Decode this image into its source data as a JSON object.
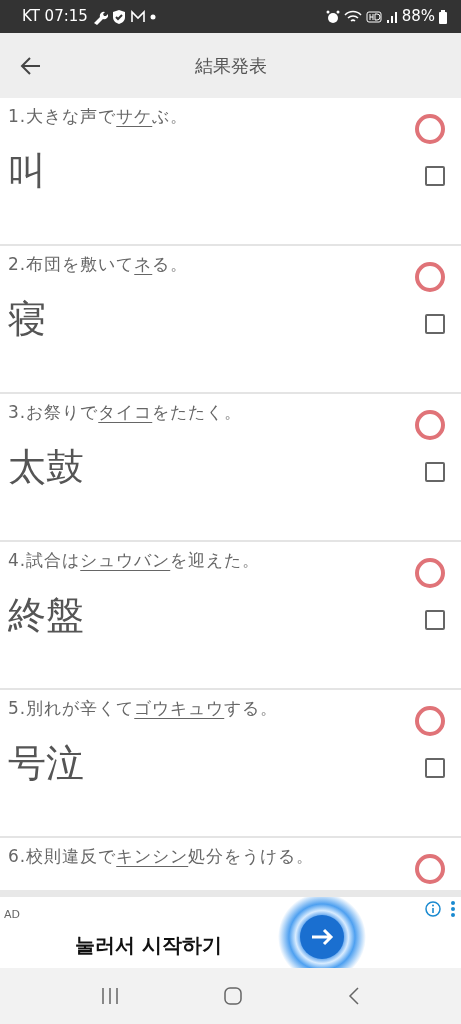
{
  "status_bar": {
    "carrier_time": "KT 07:15",
    "battery": "88%"
  },
  "app_bar": {
    "title": "結果発表"
  },
  "questions": [
    {
      "number": "1.",
      "before": "大きな声で",
      "underlined": "サケ",
      "after": "ぶ。",
      "answer": "叫",
      "correct": true,
      "checked": false
    },
    {
      "number": "2.",
      "before": "布団を敷いて",
      "underlined": "ネ",
      "after": "る。",
      "answer": "寝",
      "correct": true,
      "checked": false
    },
    {
      "number": "3.",
      "before": "お祭りで",
      "underlined": "タイコ",
      "after": "をたたく。",
      "answer": "太鼓",
      "correct": true,
      "checked": false
    },
    {
      "number": "4.",
      "before": "試合は",
      "underlined": "シュウバン",
      "after": "を迎えた。",
      "answer": "終盤",
      "correct": true,
      "checked": false
    },
    {
      "number": "5.",
      "before": "別れが辛くて",
      "underlined": "ゴウキュウ",
      "after": "する。",
      "answer": "号泣",
      "correct": true,
      "checked": false
    },
    {
      "number": "6.",
      "before": "校則違反で",
      "underlined": "キンシン",
      "after": "処分をうける。",
      "correct": true
    }
  ],
  "ad": {
    "label": "AD",
    "headline": "눌러서 시작하기"
  }
}
